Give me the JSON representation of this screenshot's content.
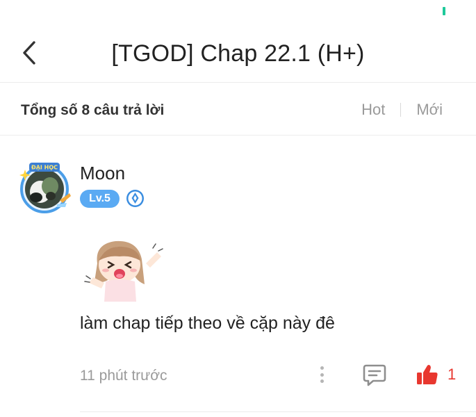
{
  "header": {
    "title": "[TGOD] Chap 22.1 (H+)",
    "back_icon": "chevron-left-icon"
  },
  "summary": {
    "count_text": "Tổng số 8 câu trả lời",
    "sort_options": [
      "Hot",
      "Mới"
    ]
  },
  "comment": {
    "username": "Moon",
    "level": "Lv.5",
    "rank_icon": "diamond-rank-icon",
    "avatar_badge_text": "ĐẠI HỌC",
    "text": "làm chap tiếp theo về cặp này đê",
    "timestamp": "11 phút trước",
    "likes": "1",
    "icons": {
      "more": "more-vertical-icon",
      "reply": "reply-icon",
      "like": "thumbs-up-icon"
    }
  },
  "colors": {
    "accent": "#5aaaf3",
    "like": "#e8372f",
    "status": "#1ec99a",
    "muted": "#9a9a9a"
  }
}
